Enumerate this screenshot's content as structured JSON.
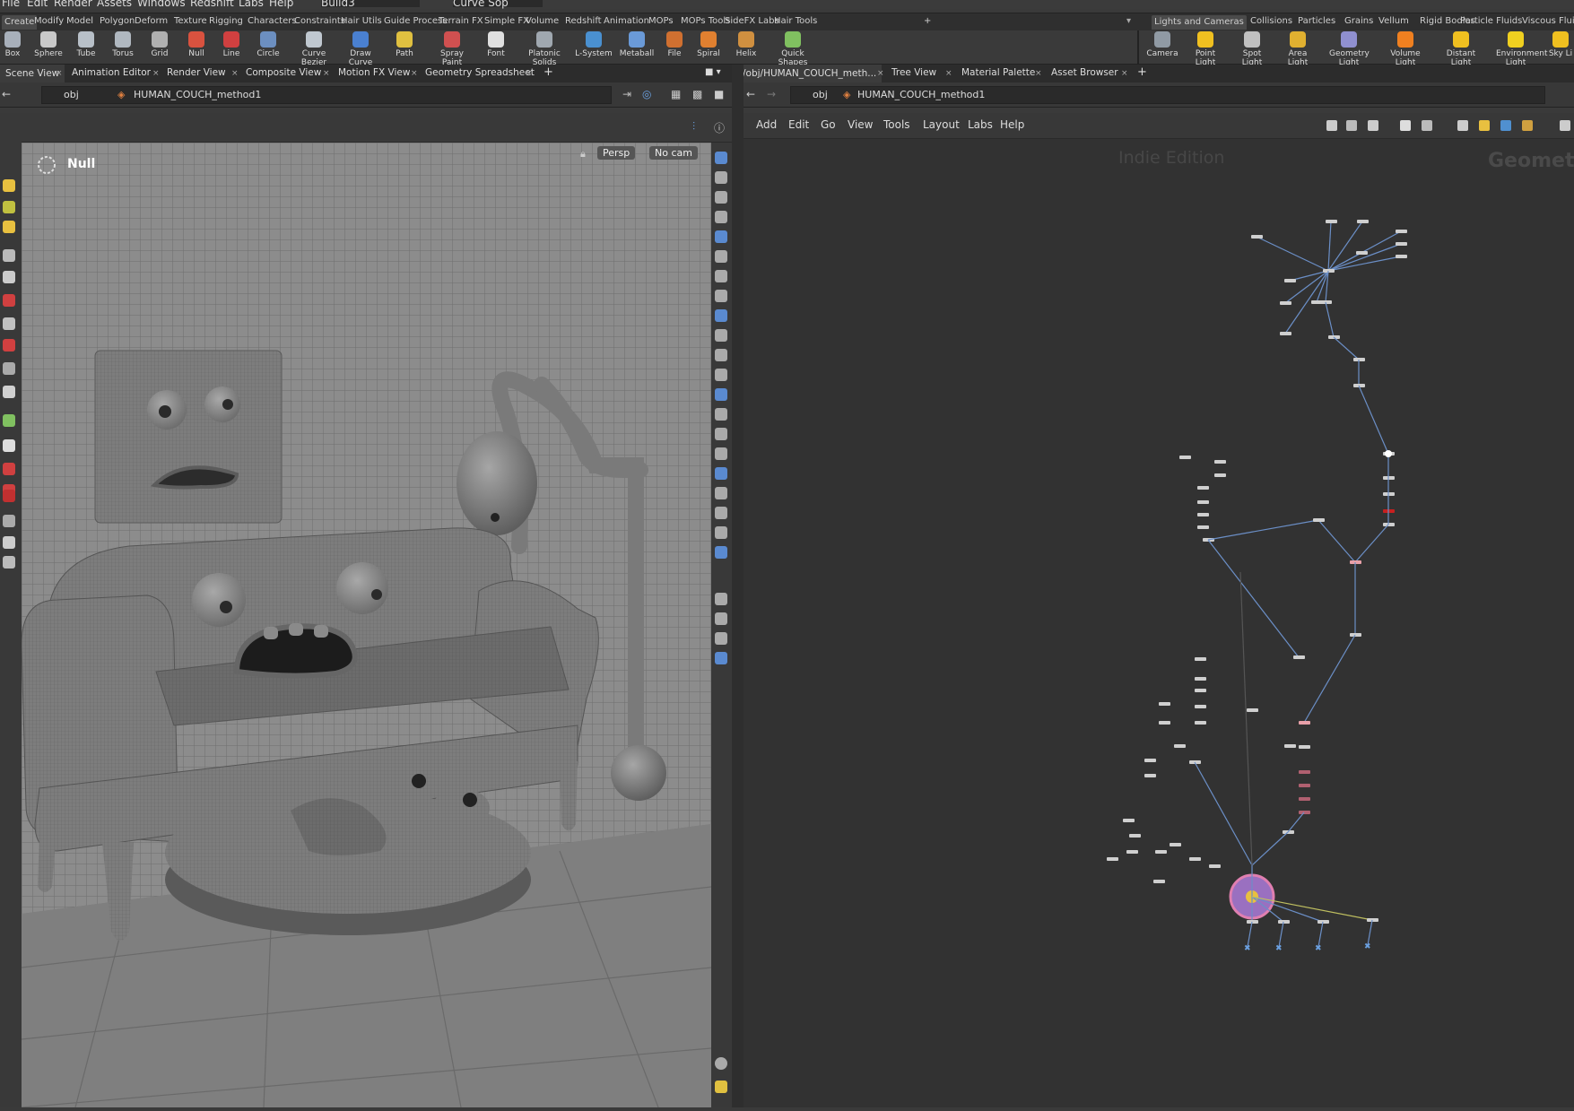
{
  "menubar": {
    "items": [
      "File",
      "Edit",
      "Render",
      "Assets",
      "Windows",
      "Redshift",
      "Labs",
      "Help"
    ],
    "desktop": "Build3",
    "network": "Curve Sop"
  },
  "shelf_tabs_left": [
    "Create",
    "Modify",
    "Model",
    "Polygon",
    "Deform",
    "Texture",
    "Rigging",
    "Characters",
    "Constraints",
    "Hair Utils",
    "Guide Process",
    "Terrain FX",
    "Simple FX",
    "Volume",
    "Redshift",
    "Animation",
    "MOPs",
    "MOPs Tools",
    "SideFX Labs",
    "Hair Tools"
  ],
  "shelf_tabs_right": [
    "Lights and Cameras",
    "Collisions",
    "Particles",
    "Grains",
    "Vellum",
    "Rigid Bodies",
    "Particle Fluids",
    "Viscous Fluids"
  ],
  "tools_left": [
    {
      "label": "Box",
      "icon": "box-icon",
      "color": "#a8b0bb"
    },
    {
      "label": "Sphere",
      "icon": "sphere-icon",
      "color": "#c9c9c9"
    },
    {
      "label": "Tube",
      "icon": "tube-icon",
      "color": "#b8c0c8"
    },
    {
      "label": "Torus",
      "icon": "torus-icon",
      "color": "#b0b8c0"
    },
    {
      "label": "Grid",
      "icon": "grid-icon",
      "color": "#b0b0b0"
    },
    {
      "label": "Null",
      "icon": "null-icon",
      "color": "#d9523f"
    },
    {
      "label": "Line",
      "icon": "line-icon",
      "color": "#d04040"
    },
    {
      "label": "Circle",
      "icon": "circle-icon",
      "color": "#6c8fc0"
    },
    {
      "label": "Curve Bezier",
      "icon": "curve-bezier-icon",
      "color": "#c0c8d0"
    },
    {
      "label": "Draw Curve",
      "icon": "draw-curve-icon",
      "color": "#4a80d0"
    },
    {
      "label": "Path",
      "icon": "path-icon",
      "color": "#e0c040"
    },
    {
      "label": "Spray Paint",
      "icon": "spray-paint-icon",
      "color": "#d05050"
    },
    {
      "label": "Font",
      "icon": "font-icon",
      "color": "#e0e0e0"
    },
    {
      "label": "Platonic Solids",
      "icon": "platonic-solids-icon",
      "color": "#a0a8b0"
    },
    {
      "label": "L-System",
      "icon": "l-system-icon",
      "color": "#4a90d0"
    },
    {
      "label": "Metaball",
      "icon": "metaball-icon",
      "color": "#6a9ad8"
    },
    {
      "label": "File",
      "icon": "file-icon",
      "color": "#d07030"
    },
    {
      "label": "Spiral",
      "icon": "spiral-icon",
      "color": "#e08030"
    },
    {
      "label": "Helix",
      "icon": "helix-icon",
      "color": "#d09040"
    },
    {
      "label": "Quick Shapes",
      "icon": "quick-shapes-icon",
      "color": "#80c060"
    }
  ],
  "tools_right": [
    {
      "label": "Camera",
      "icon": "camera-icon",
      "color": "#909aa4"
    },
    {
      "label": "Point Light",
      "icon": "point-light-icon",
      "color": "#f0c020"
    },
    {
      "label": "Spot Light",
      "icon": "spot-light-icon",
      "color": "#c0c0c0"
    },
    {
      "label": "Area Light",
      "icon": "area-light-icon",
      "color": "#e0b030"
    },
    {
      "label": "Geometry Light",
      "icon": "geometry-light-icon",
      "color": "#9090d0"
    },
    {
      "label": "Volume Light",
      "icon": "volume-light-icon",
      "color": "#f08020"
    },
    {
      "label": "Distant Light",
      "icon": "distant-light-icon",
      "color": "#f0c020"
    },
    {
      "label": "Environment Light",
      "icon": "environment-light-icon",
      "color": "#f0d020"
    },
    {
      "label": "Sky Li",
      "icon": "sky-light-icon",
      "color": "#f0c020"
    }
  ],
  "left_pane": {
    "tabs": [
      "Scene View",
      "Animation Editor",
      "Render View",
      "Composite View",
      "Motion FX View",
      "Geometry Spreadsheet"
    ],
    "path_root": "obj",
    "path_node": "HUMAN_COUCH_method1"
  },
  "right_pane": {
    "tabs": [
      "/obj/HUMAN_COUCH_meth...",
      "Tree View",
      "Material Palette",
      "Asset Browser"
    ],
    "path_root": "obj",
    "path_node": "HUMAN_COUCH_method1",
    "menu": [
      "Add",
      "Edit",
      "Go",
      "View",
      "Tools",
      "Layout",
      "Labs",
      "Help"
    ],
    "watermark_edition": "Indie Edition",
    "watermark_context": "Geometry"
  },
  "viewport": {
    "selection_label": "Null",
    "camera_mode": "Persp",
    "camera": "No cam"
  },
  "colors": {
    "wire": "#6b8fc7",
    "selected_node": "#e07fb0",
    "error_node": "#c82020",
    "bg_network": "#323232"
  }
}
